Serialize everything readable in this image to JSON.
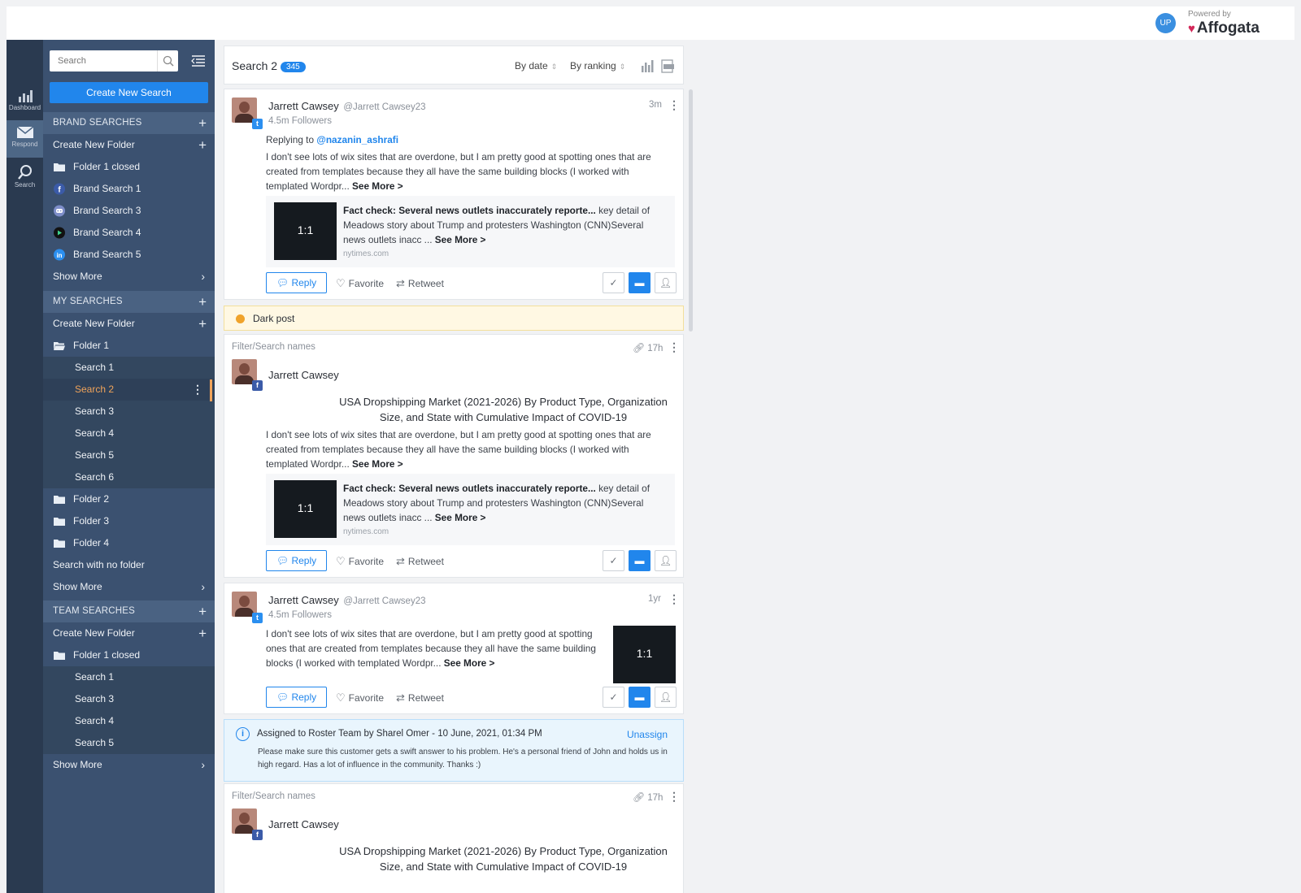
{
  "header": {
    "user_initials": "UP",
    "powered_by": "Powered by",
    "brand": "Affogata"
  },
  "rail": [
    {
      "label": "Dashboard",
      "icon": "bar-chart-icon"
    },
    {
      "label": "Respond",
      "icon": "envelope-icon"
    },
    {
      "label": "Search",
      "icon": "search-icon"
    }
  ],
  "sidebar": {
    "search_placeholder": "Search",
    "create_new_search": "Create New Search",
    "brand_searches": {
      "title": "BRAND SEARCHES",
      "create_folder": "Create New Folder",
      "items": [
        {
          "label": "Folder 1 closed",
          "icon": "folder-icon"
        },
        {
          "label": "Brand Search 1",
          "icon": "facebook-icon"
        },
        {
          "label": "Brand Search 3",
          "icon": "discord-icon"
        },
        {
          "label": "Brand Search 4",
          "icon": "play-icon"
        },
        {
          "label": "Brand Search 5",
          "icon": "linkedin-icon"
        }
      ],
      "show_more": "Show More"
    },
    "my_searches": {
      "title": "MY SEARCHES",
      "create_folder": "Create New Folder",
      "folder_open": "Folder 1",
      "searches": [
        "Search 1",
        "Search 2",
        "Search 3",
        "Search 4",
        "Search 5",
        "Search 6"
      ],
      "folders": [
        "Folder 2",
        "Folder 3",
        "Folder 4"
      ],
      "no_folder": "Search with no folder",
      "show_more": "Show More"
    },
    "team_searches": {
      "title": "TEAM SEARCHES",
      "create_folder": "Create New Folder",
      "folder": "Folder 1 closed",
      "searches": [
        "Search 1",
        "Search 3",
        "Search 4",
        "Search 5"
      ],
      "show_more": "Show More"
    }
  },
  "feed": {
    "title": "Search 2",
    "count": "345",
    "sort_date": "By date",
    "sort_ranking": "By ranking",
    "posts": [
      {
        "author": "Jarrett Cawsey",
        "handle": "@Jarrett Cawsey23",
        "followers": "4.5m Followers",
        "time": "3m",
        "replying_label": "Replying to",
        "replying_to": "@nazanin_ashrafi",
        "text": "I don't see lots of wix sites that are overdone, but I am pretty good at spotting ones that are created from templates because they all have the same building blocks (I worked with templated Wordpr...",
        "see_more": "See More >",
        "preview_title": "Fact check: Several news outlets inaccurately reporte...",
        "preview_text": "key detail of Meadows story about Trump and protesters Washington (CNN)Several news outlets inacc ...",
        "preview_more": "See More >",
        "preview_domain": "nytimes.com",
        "thumb": "1:1"
      },
      {
        "filter_names": "Filter/Search names",
        "time": "17h",
        "author": "Jarrett Cawsey",
        "headline": "USA Dropshipping Market (2021-2026) By Product Type, Organization Size, and State with Cumulative Impact of COVID-19",
        "text": "I don't see lots of wix sites that are overdone, but I am pretty good at spotting ones that are created from templates because they all have the same building blocks (I worked with templated Wordpr...",
        "see_more": "See More >",
        "preview_title": "Fact check: Several news outlets inaccurately reporte...",
        "preview_text": "key detail of Meadows story about Trump and protesters Washington (CNN)Several news outlets inacc ...",
        "preview_more": "See More >",
        "preview_domain": "nytimes.com",
        "thumb": "1:1"
      },
      {
        "author": "Jarrett Cawsey",
        "handle": "@Jarrett Cawsey23",
        "followers": "4.5m Followers",
        "time": "1yr",
        "text": "I don't see lots of wix sites that are overdone, but I am pretty good at spotting ones that are created from templates because they all have the same building blocks (I worked with templated Wordpr...",
        "see_more": "See More >",
        "thumb": "1:1"
      },
      {
        "filter_names": "Filter/Search names",
        "time": "17h",
        "author": "Jarrett Cawsey",
        "headline": "USA Dropshipping Market (2021-2026) By Product Type, Organization Size, and State with Cumulative Impact of COVID-19"
      }
    ],
    "actions": {
      "reply": "Reply",
      "favorite": "Favorite",
      "retweet": "Retweet"
    },
    "dark_post": "Dark post",
    "assignment": {
      "text": "Assigned to Roster Team by Sharel Omer - 10 June, 2021, 01:34 PM",
      "unassign": "Unassign",
      "note": "Please make sure this customer gets a swift answer to his problem. He's a personal friend of John and holds us in high regard. Has a lot of influence in the community. Thanks :)"
    }
  },
  "colors": {
    "accent": "#2186ec",
    "sidebar": "#3b5170",
    "rail": "#2a3a50",
    "selected": "#f0a35a"
  }
}
